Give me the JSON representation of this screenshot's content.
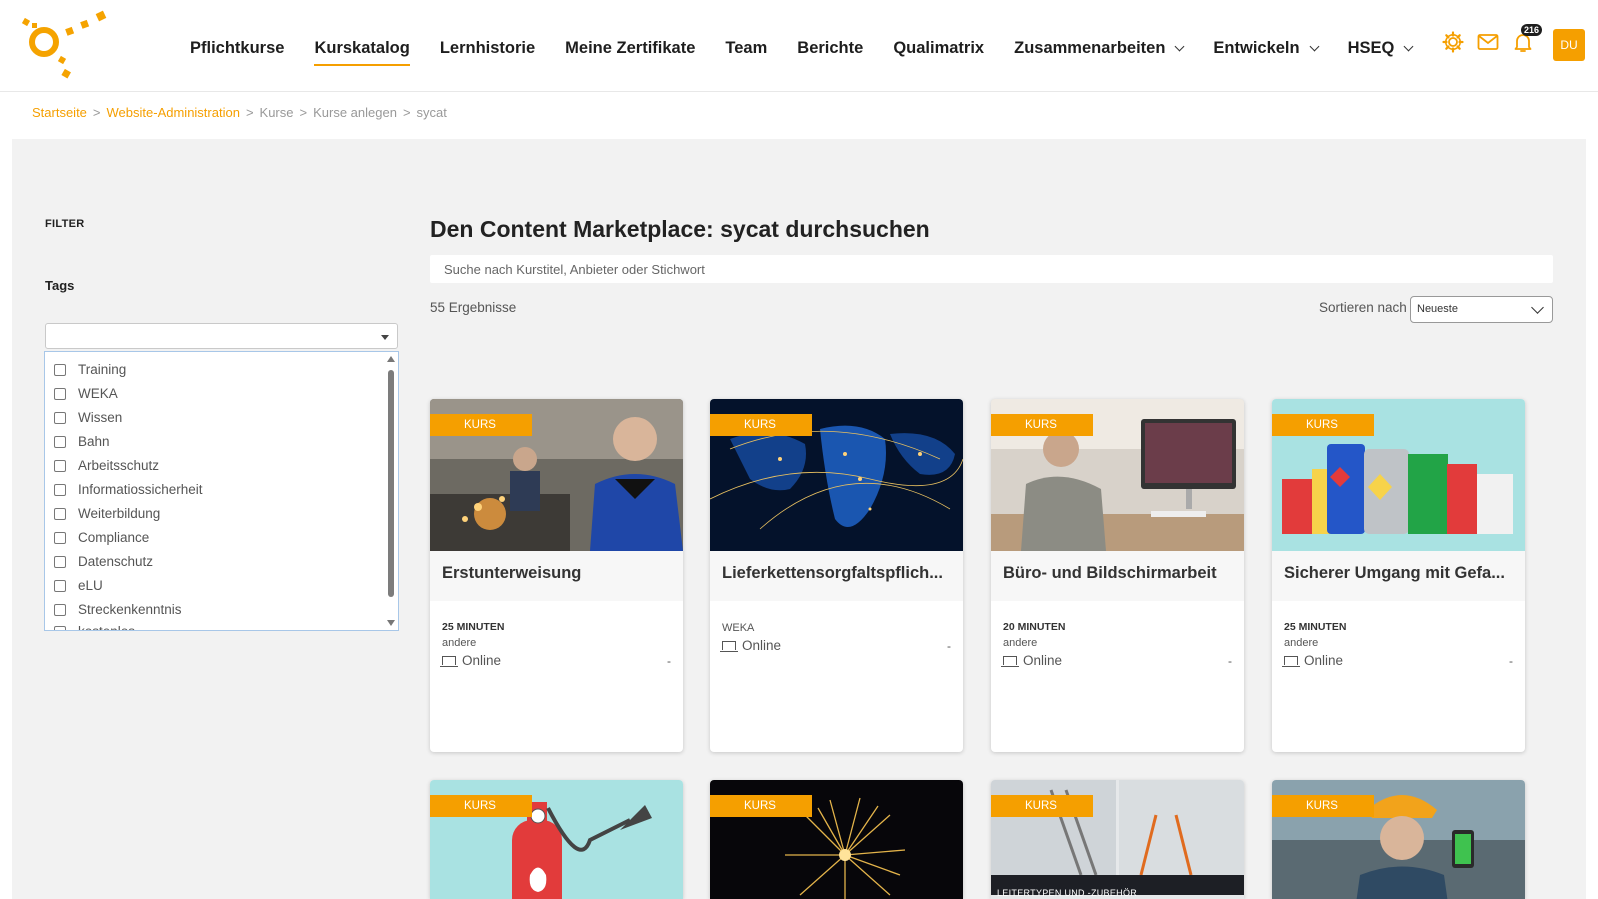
{
  "nav": {
    "items": [
      {
        "label": "Pflichtkurse",
        "active": false,
        "dropdown": false
      },
      {
        "label": "Kurskatalog",
        "active": true,
        "dropdown": false
      },
      {
        "label": "Lernhistorie",
        "active": false,
        "dropdown": false
      },
      {
        "label": "Meine Zertifikate",
        "active": false,
        "dropdown": false
      },
      {
        "label": "Team",
        "active": false,
        "dropdown": false
      },
      {
        "label": "Berichte",
        "active": false,
        "dropdown": false
      },
      {
        "label": "Qualimatrix",
        "active": false,
        "dropdown": false
      },
      {
        "label": "Zusammenarbeiten",
        "active": false,
        "dropdown": true
      },
      {
        "label": "Entwickeln",
        "active": false,
        "dropdown": true
      },
      {
        "label": "HSEQ",
        "active": false,
        "dropdown": true
      }
    ],
    "icons": [
      "gear-icon",
      "mail-icon",
      "bell-icon"
    ],
    "notification_count": "216",
    "avatar_initials": "DU",
    "accent_color": "#f59f00"
  },
  "breadcrumb": {
    "items": [
      {
        "label": "Startseite",
        "link": true
      },
      {
        "label": "Website-Administration",
        "link": true
      },
      {
        "label": "Kurse",
        "link": false
      },
      {
        "label": "Kurse anlegen",
        "link": false
      },
      {
        "label": "sycat",
        "link": false
      }
    ],
    "separator": ">"
  },
  "filter": {
    "title": "FILTER",
    "tags_label": "Tags",
    "tags": [
      "Training",
      "WEKA",
      "Wissen",
      "Bahn",
      "Arbeitsschutz",
      "Informatiossicherheit",
      "Weiterbildung",
      "Compliance",
      "Datenschutz",
      "eLU",
      "Streckenkenntnis",
      "kostenlos"
    ]
  },
  "main": {
    "title": "Den Content Marketplace: sycat durchsuchen",
    "search_placeholder": "Suche nach Kurstitel, Anbieter oder Stichwort",
    "results": "55 Ergebnisse",
    "sort_label": "Sortieren nach",
    "sort_value": "Neueste"
  },
  "cards": [
    {
      "badge": "KURS",
      "title": "Erstunterweisung",
      "duration": "25 MINUTEN",
      "provider": "andere",
      "mode": "Online",
      "extra": "-",
      "image": "worker-grinding"
    },
    {
      "badge": "KURS",
      "title": "Lieferkettensorgfaltspflich...",
      "duration": "",
      "provider": "WEKA",
      "mode": "Online",
      "extra": "-",
      "image": "world-map-night"
    },
    {
      "badge": "KURS",
      "title": "Büro- und Bildschirmarbeit",
      "duration": "20 MINUTEN",
      "provider": "andere",
      "mode": "Online",
      "extra": "-",
      "image": "office-desk"
    },
    {
      "badge": "KURS",
      "title": "Sicherer Umgang mit Gefa...",
      "duration": "25 MINUTEN",
      "provider": "andere",
      "mode": "Online",
      "extra": "-",
      "image": "hazard-containers"
    },
    {
      "badge": "KURS",
      "image": "fire-extinguisher"
    },
    {
      "badge": "KURS",
      "image": "fireworks"
    },
    {
      "badge": "KURS",
      "image": "ladders",
      "image_caption": "LEITERTYPEN UND -ZUBEHÖR"
    },
    {
      "badge": "KURS",
      "image": "worker-phone"
    }
  ]
}
